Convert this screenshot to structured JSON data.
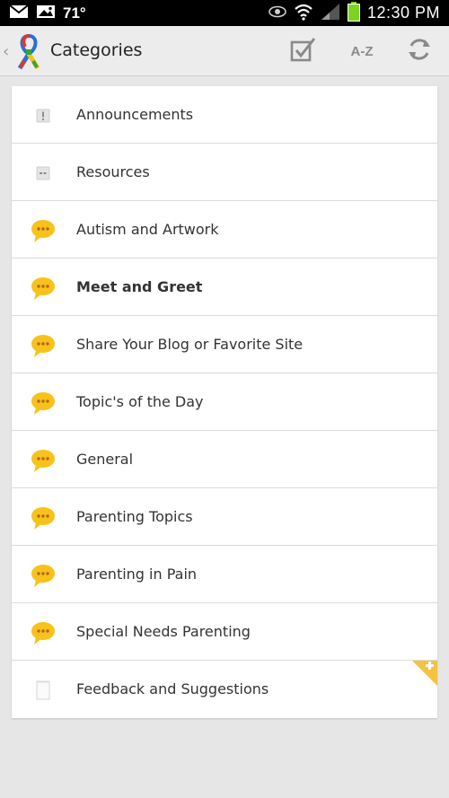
{
  "status_bar": {
    "temperature": "71°",
    "clock": "12:30 PM",
    "icons": [
      "mail-icon",
      "image-icon",
      "eye-icon",
      "wifi-icon",
      "signal-icon",
      "battery-icon"
    ]
  },
  "action_bar": {
    "title": "Categories",
    "sort_label": "A-Z",
    "icons": [
      "back-chevron-icon",
      "autism-ribbon-logo",
      "mark-read-check-icon",
      "refresh-icon"
    ]
  },
  "categories": [
    {
      "label": "Announcements",
      "icon": "announcement-icon"
    },
    {
      "label": "Resources",
      "icon": "resources-icon"
    },
    {
      "label": "Autism and Artwork",
      "icon": "chat-bubble-icon"
    },
    {
      "label": "Meet and Greet",
      "icon": "chat-bubble-icon"
    },
    {
      "label": "Share Your Blog or Favorite Site",
      "icon": "chat-bubble-icon"
    },
    {
      "label": "Topic's of the Day",
      "icon": "chat-bubble-icon"
    },
    {
      "label": "General",
      "icon": "chat-bubble-icon"
    },
    {
      "label": "Parenting Topics",
      "icon": "chat-bubble-icon"
    },
    {
      "label": "Parenting in Pain",
      "icon": "chat-bubble-icon"
    },
    {
      "label": "Special Needs Parenting",
      "icon": "chat-bubble-icon"
    },
    {
      "label": "Feedback and Suggestions",
      "icon": "note-page-icon"
    }
  ],
  "colors": {
    "status_bar_bg": "#000000",
    "action_bar_bg": "#ececec",
    "page_bg": "#e6e6e6",
    "chat_bubble": "#f7c21a",
    "corner_badge": "#f5c242",
    "battery": "#7ed321"
  }
}
